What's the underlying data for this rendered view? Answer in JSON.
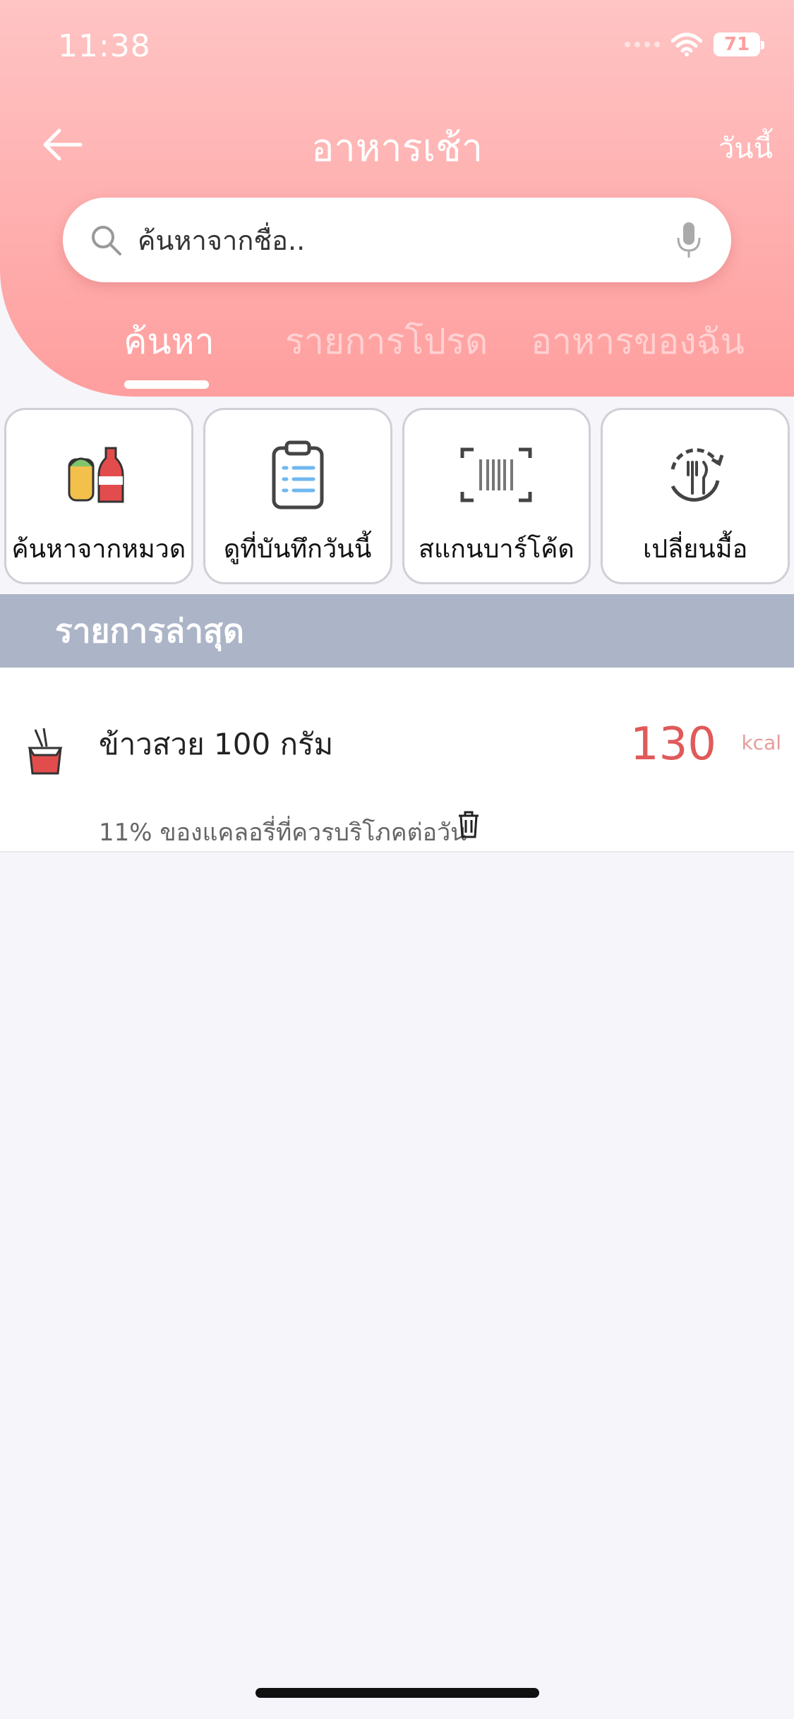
{
  "status_bar": {
    "time": "11:38",
    "battery": "71"
  },
  "header": {
    "title": "อาหารเช้า",
    "today": "วันนี้"
  },
  "search": {
    "placeholder": "ค้นหาจากชื่อ.."
  },
  "tabs": [
    {
      "label": "ค้นหา",
      "active": true
    },
    {
      "label": "รายการโปรด",
      "active": false
    },
    {
      "label": "อาหารของฉัน",
      "active": false
    }
  ],
  "quick_actions": [
    {
      "label": "ค้นหาจากหมวด",
      "icon": "food-category-icon"
    },
    {
      "label": "ดูที่บันทึกวันนี้",
      "icon": "clipboard-icon"
    },
    {
      "label": "สแกนบาร์โค้ด",
      "icon": "barcode-scan-icon"
    },
    {
      "label": "เปลี่ยนมื้อ",
      "icon": "change-meal-icon"
    }
  ],
  "recent": {
    "section_title": "รายการล่าสุด",
    "items": [
      {
        "name": "ข้าวสวย 100 กรัม",
        "kcal": "130",
        "unit": "kcal",
        "percent_text": "11% ของแคลอรี่ที่ควรบริโภคต่อวัน"
      }
    ]
  },
  "colors": {
    "header_top": "#ffc4c4",
    "header_bottom": "#ff9e9e",
    "section_bar": "#acb5c7",
    "kcal": "#e05a5a"
  }
}
